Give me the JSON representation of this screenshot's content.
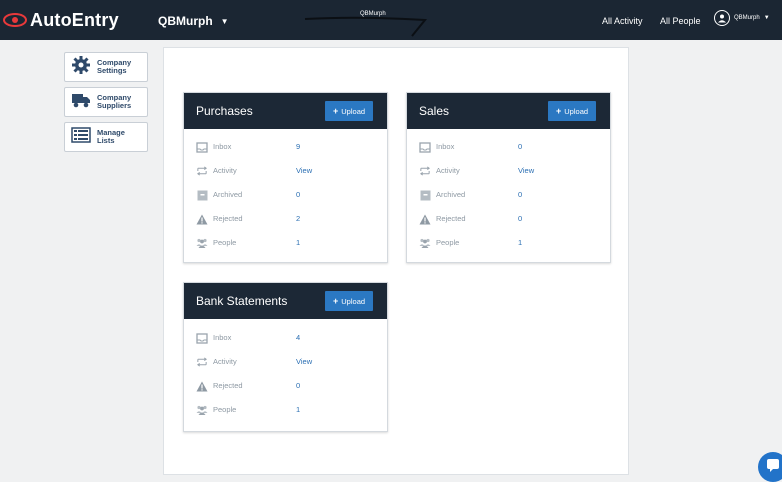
{
  "app": {
    "name": "AutoEntry",
    "brand_color": "#e8393b"
  },
  "topbar": {
    "company": "QBMurph",
    "company_center": "QBMurph",
    "links": [
      "All Activity",
      "All People"
    ],
    "user": "QBMurph"
  },
  "sidebar": {
    "items": [
      {
        "label": "Company Settings",
        "icon": "gear-icon"
      },
      {
        "label": "Company Suppliers",
        "icon": "truck-icon"
      },
      {
        "label": "Manage Lists",
        "icon": "list-icon"
      }
    ]
  },
  "upload_label": "Upload",
  "cards": {
    "purchases": {
      "title": "Purchases",
      "rows": [
        {
          "label": "Inbox",
          "value": "9"
        },
        {
          "label": "Activity",
          "value": "View"
        },
        {
          "label": "Archived",
          "value": "0"
        },
        {
          "label": "Rejected",
          "value": "2"
        },
        {
          "label": "People",
          "value": "1"
        }
      ]
    },
    "sales": {
      "title": "Sales",
      "rows": [
        {
          "label": "Inbox",
          "value": "0"
        },
        {
          "label": "Activity",
          "value": "View"
        },
        {
          "label": "Archived",
          "value": "0"
        },
        {
          "label": "Rejected",
          "value": "0"
        },
        {
          "label": "People",
          "value": "1"
        }
      ]
    },
    "bank": {
      "title": "Bank Statements",
      "rows": [
        {
          "label": "Inbox",
          "value": "4"
        },
        {
          "label": "Activity",
          "value": "View"
        },
        {
          "label": "Rejected",
          "value": "0"
        },
        {
          "label": "People",
          "value": "1"
        }
      ]
    }
  }
}
